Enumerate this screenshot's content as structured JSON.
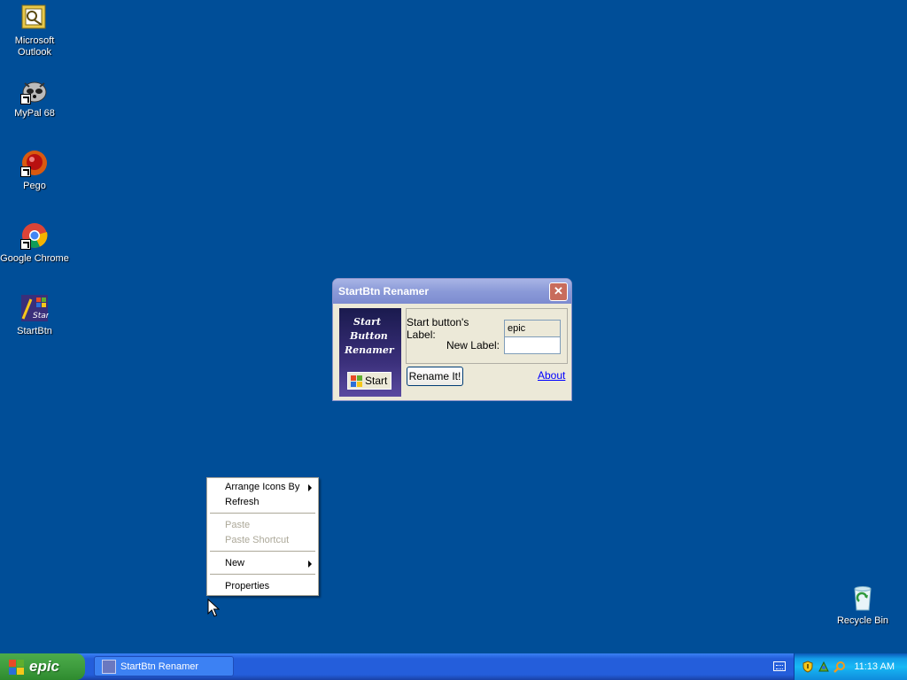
{
  "desktop": {
    "icons": [
      {
        "label": "Microsoft Outlook",
        "icon": "outlook-icon"
      },
      {
        "label": "MyPal 68",
        "icon": "mypal-icon"
      },
      {
        "label": "Pego",
        "icon": "pego-icon"
      },
      {
        "label": "Google Chrome",
        "icon": "chrome-icon"
      },
      {
        "label": "StartBtn",
        "icon": "startbtn-icon"
      },
      {
        "label": "Recycle Bin",
        "icon": "recycle-bin-icon"
      }
    ]
  },
  "dialog": {
    "title": "StartBtn Renamer",
    "art_text": [
      "Start",
      "Button",
      "Renamer"
    ],
    "art_start_label": "Start",
    "current_label_caption": "Start button's Label:",
    "current_label_value": "epic",
    "new_label_caption": "New Label:",
    "new_label_value": "",
    "rename_button": "Rename It!",
    "about_link": "About"
  },
  "context_menu": {
    "items": [
      {
        "label": "Arrange Icons By",
        "submenu": true,
        "disabled": false
      },
      {
        "label": "Refresh",
        "submenu": false,
        "disabled": false
      },
      {
        "label": "Paste",
        "submenu": false,
        "disabled": true
      },
      {
        "label": "Paste Shortcut",
        "submenu": false,
        "disabled": true
      },
      {
        "label": "New",
        "submenu": true,
        "disabled": false
      },
      {
        "label": "Properties",
        "submenu": false,
        "disabled": false
      }
    ]
  },
  "taskbar": {
    "start_label": "epic",
    "task_items": [
      {
        "label": "StartBtn Renamer"
      }
    ],
    "clock": "11:13 AM"
  },
  "colors": {
    "desktop": "#004E98",
    "taskbar": "#245EDB",
    "start_button": "#3C9A3C"
  }
}
